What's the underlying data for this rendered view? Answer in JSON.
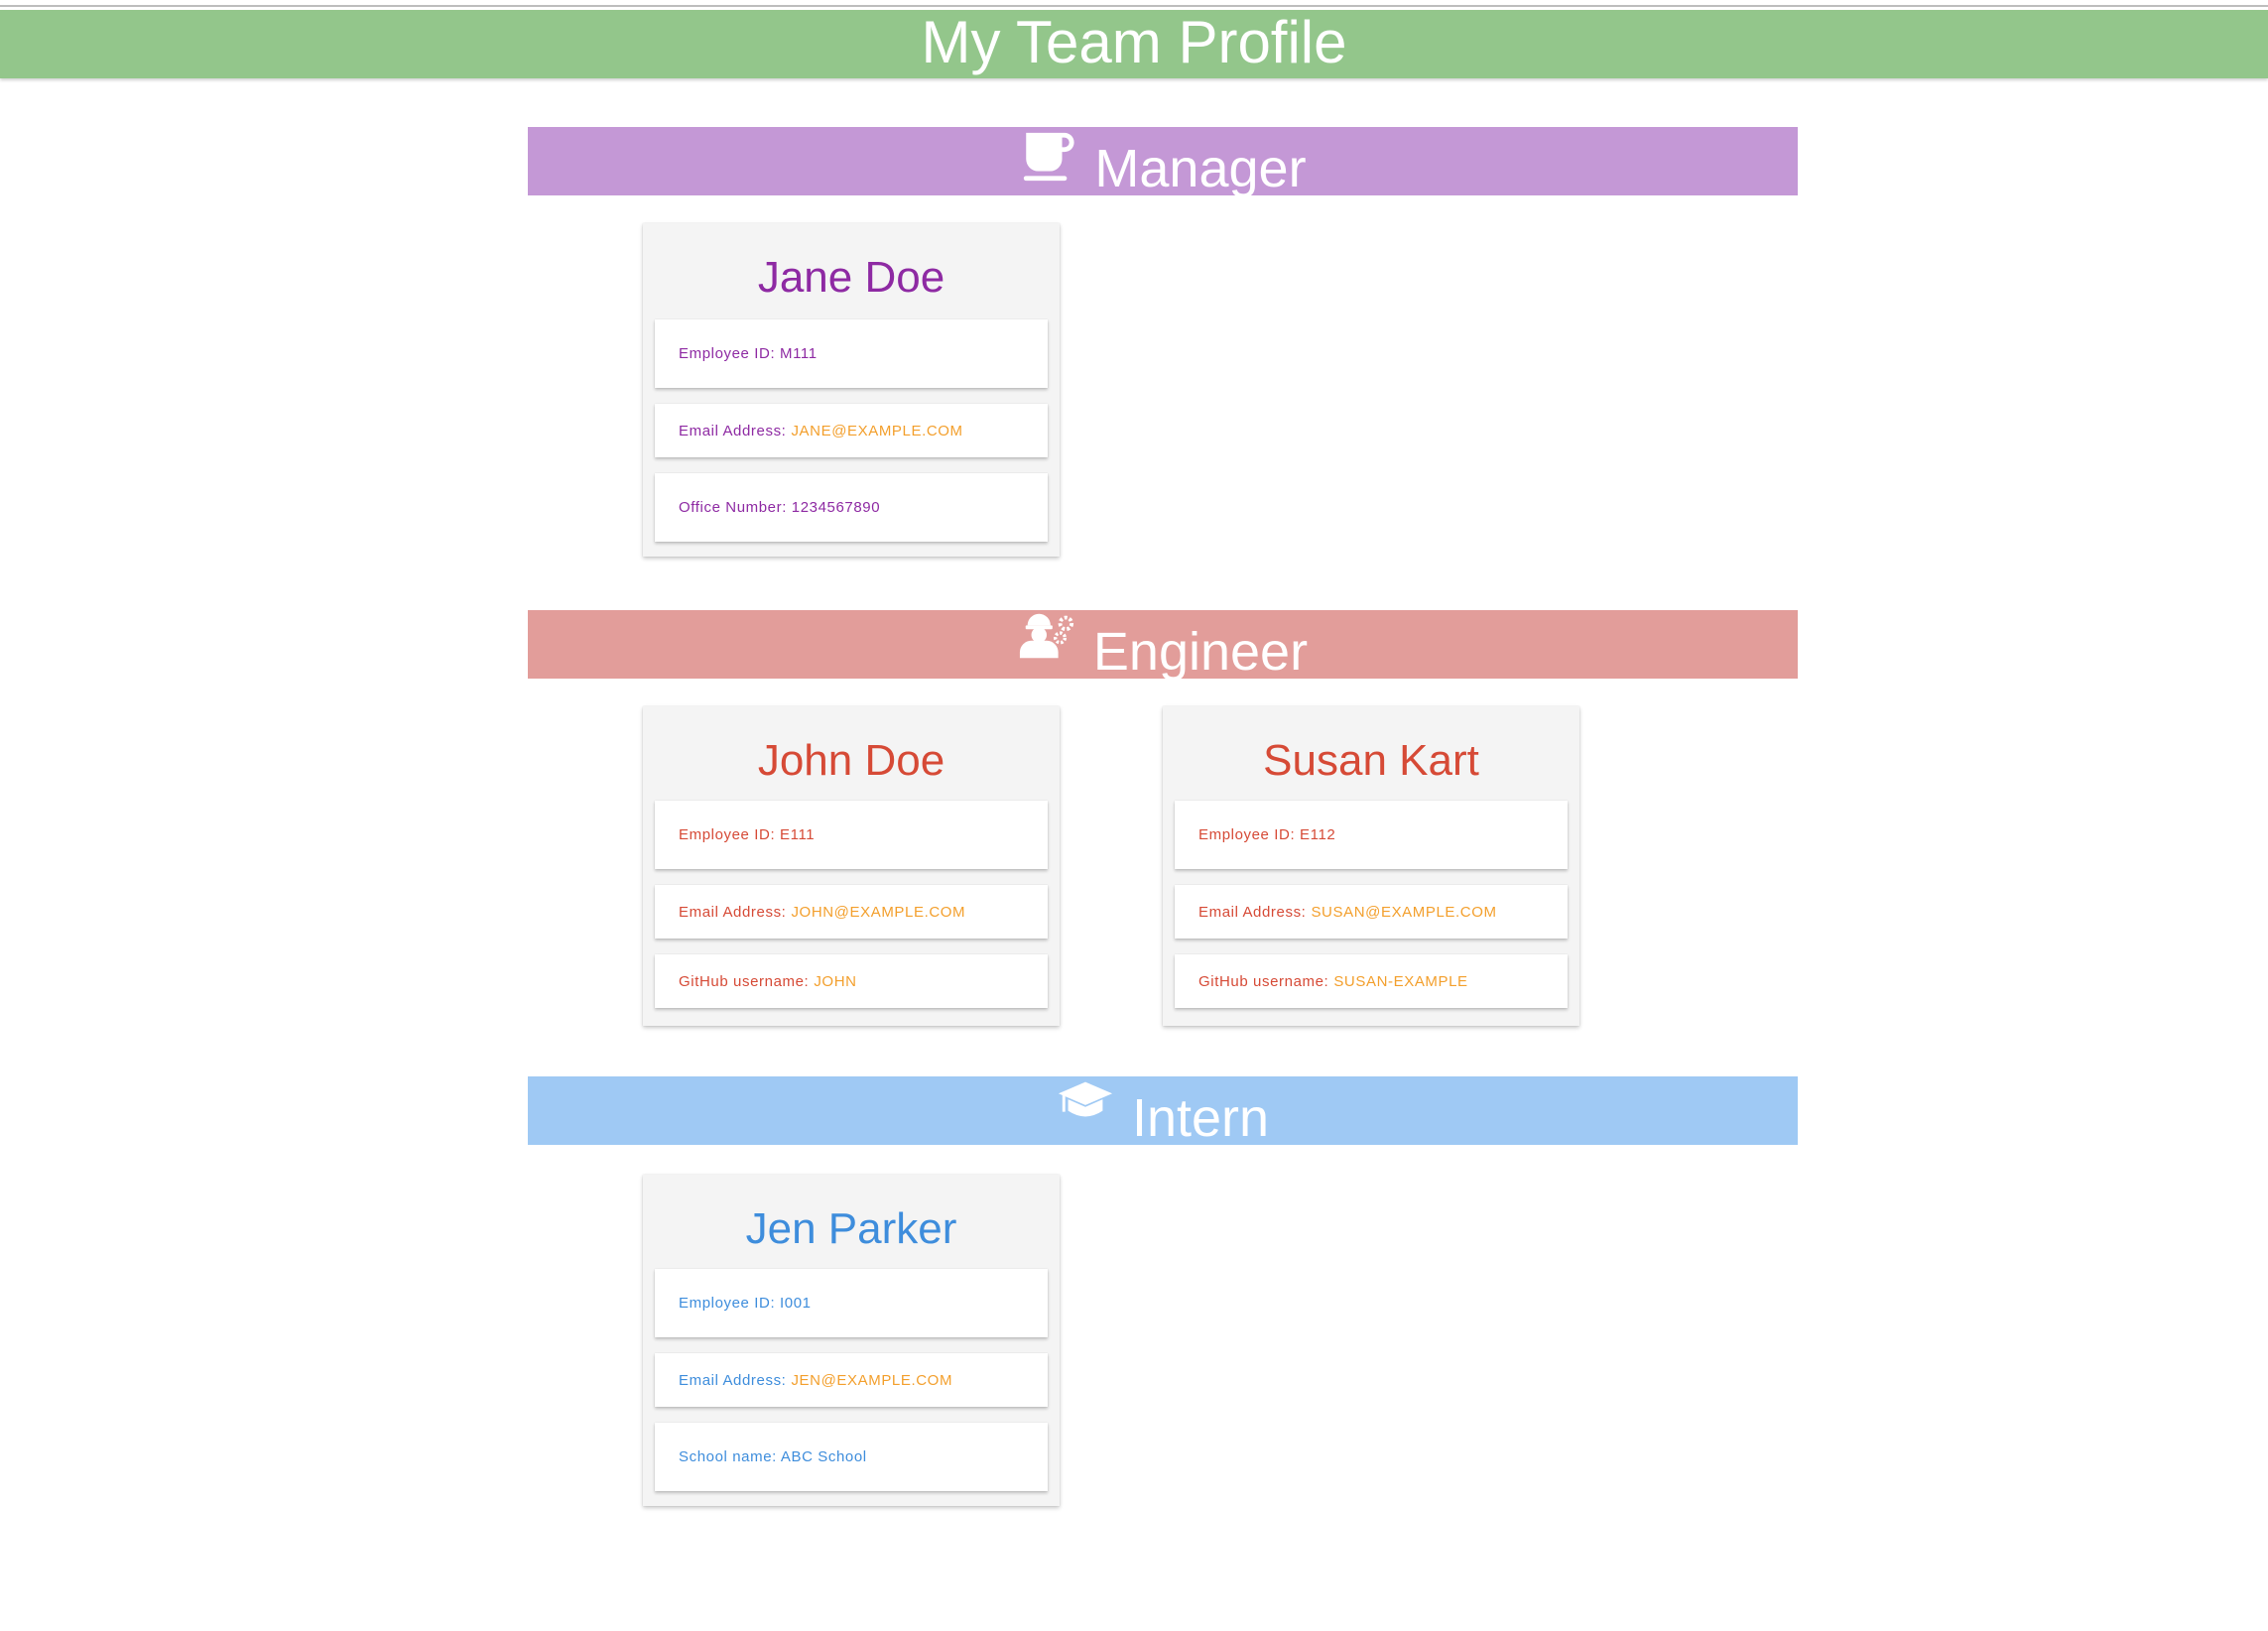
{
  "page": {
    "title": "My Team Profile"
  },
  "colors": {
    "header": "#93c68b",
    "manager_bar": "#c498d6",
    "engineer_bar": "#e29d9a",
    "intern_bar": "#9fc9f4",
    "manager_text": "#8e2aa3",
    "engineer_text": "#d64a36",
    "intern_text": "#3e8ddc",
    "accent_value": "#f39f2c"
  },
  "sections": {
    "manager": {
      "title": "Manager",
      "icon": "coffee-cup-icon",
      "cards": [
        {
          "name": "Jane Doe",
          "id_label": "Employee ID: M111",
          "email_label": "Email Address:",
          "email": "JANE@EXAMPLE.COM",
          "extra_label": "Office Number: 1234567890"
        }
      ]
    },
    "engineer": {
      "title": "Engineer",
      "icon": "engineer-gears-icon",
      "cards": [
        {
          "name": "John Doe",
          "id_label": "Employee ID: E111",
          "email_label": "Email Address:",
          "email": "JOHN@EXAMPLE.COM",
          "extra_label": "GitHub username:",
          "extra_value": "JOHN"
        },
        {
          "name": "Susan Kart",
          "id_label": "Employee ID: E112",
          "email_label": "Email Address:",
          "email": "SUSAN@EXAMPLE.COM",
          "extra_label": "GitHub username:",
          "extra_value": "SUSAN-EXAMPLE"
        }
      ]
    },
    "intern": {
      "title": "Intern",
      "icon": "graduation-cap-icon",
      "cards": [
        {
          "name": "Jen Parker",
          "id_label": "Employee ID: I001",
          "email_label": "Email Address:",
          "email": "JEN@EXAMPLE.COM",
          "extra_label": "School name: ABC School"
        }
      ]
    }
  }
}
